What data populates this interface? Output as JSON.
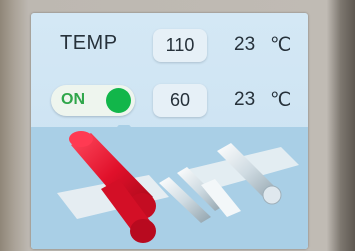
{
  "temp": {
    "label": "TEMP",
    "setpoint": "110",
    "actual": "23",
    "unit": "℃"
  },
  "heater": {
    "toggle_label": "ON",
    "toggle_state": "on",
    "setpoint": "60",
    "actual": "23",
    "unit": "℃"
  },
  "colors": {
    "screen_bg": "#d4e8f5",
    "toggle_on": "#12b64a",
    "heated_roller": "#e0102a"
  },
  "diagram": {
    "icons": [
      "heated-roller-icon",
      "rollers-icon"
    ]
  }
}
